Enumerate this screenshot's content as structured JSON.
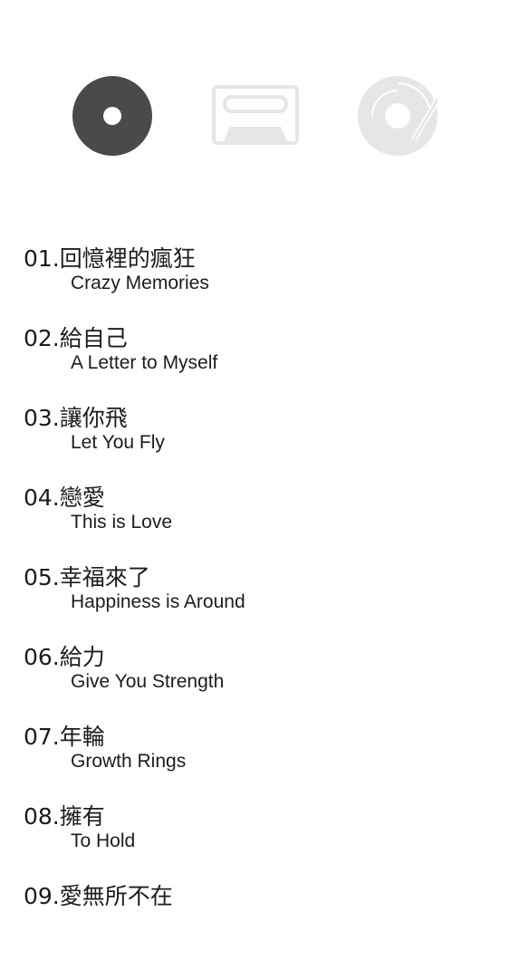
{
  "colors": {
    "active_icon": "#4a4a4a",
    "inactive_icon": "#e6e6e6",
    "text": "#1c1c1c",
    "background": "#ffffff"
  },
  "format_selector": [
    {
      "icon": "cd-icon",
      "active": true
    },
    {
      "icon": "cassette-icon",
      "active": false
    },
    {
      "icon": "vinyl-record-icon",
      "active": false
    }
  ],
  "tracks": [
    {
      "title": "01.回憶裡的瘋狂",
      "subtitle": "Crazy Memories"
    },
    {
      "title": "02.給自己",
      "subtitle": "A Letter to Myself"
    },
    {
      "title": "03.讓你飛",
      "subtitle": "Let You Fly"
    },
    {
      "title": "04.戀愛",
      "subtitle": "This is Love"
    },
    {
      "title": "05.幸福來了",
      "subtitle": "Happiness is Around"
    },
    {
      "title": "06.給力",
      "subtitle": "Give You Strength"
    },
    {
      "title": "07.年輪",
      "subtitle": "Growth Rings"
    },
    {
      "title": "08.擁有",
      "subtitle": "To Hold"
    },
    {
      "title": "09.愛無所不在",
      "subtitle": ""
    }
  ]
}
